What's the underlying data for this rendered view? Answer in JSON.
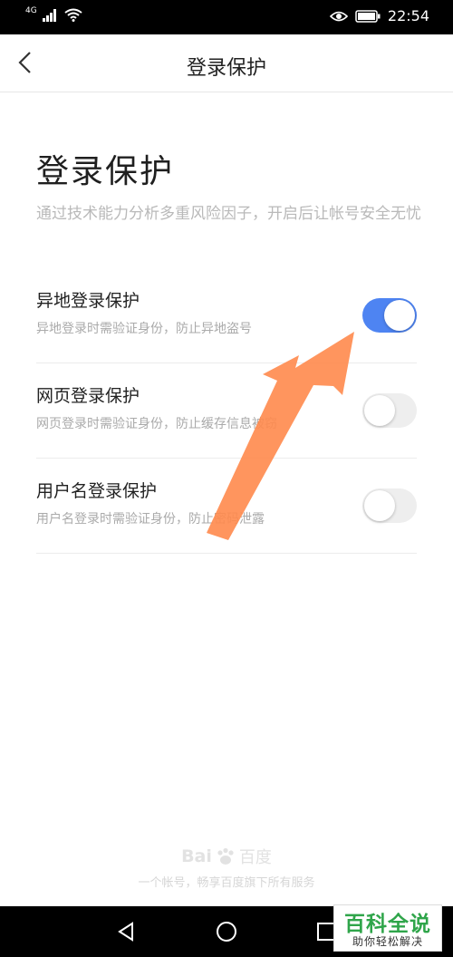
{
  "status_bar": {
    "network_label": "4G",
    "time": "22:54",
    "icons": [
      "signal-icon",
      "wifi-icon",
      "eye-icon",
      "battery-icon"
    ]
  },
  "navbar": {
    "title": "登录保护",
    "back_icon": "chevron-left-icon"
  },
  "page": {
    "heading": "登录保护",
    "description": "通过技术能力分析多重风险因子，开启后让帐号安全无忧"
  },
  "settings": [
    {
      "title": "异地登录保护",
      "subtitle": "异地登录时需验证身份，防止异地盗号",
      "enabled": true
    },
    {
      "title": "网页登录保护",
      "subtitle": "网页登录时需验证身份，防止缓存信息被窃",
      "enabled": false
    },
    {
      "title": "用户名登录保护",
      "subtitle": "用户名登录时需验证身份，防止密码泄露",
      "enabled": false
    }
  ],
  "footer": {
    "logo_text": "Bai",
    "logo_cn": "百度",
    "slogan": "一个帐号，畅享百度旗下所有服务"
  },
  "watermark": {
    "top": "百科全说",
    "bottom": "助你轻松解决"
  },
  "colors": {
    "toggle_on": "#4e84f2",
    "toggle_off": "#eeeeee",
    "arrow": "#ff8a4c",
    "watermark_green": "#2fa54a"
  }
}
